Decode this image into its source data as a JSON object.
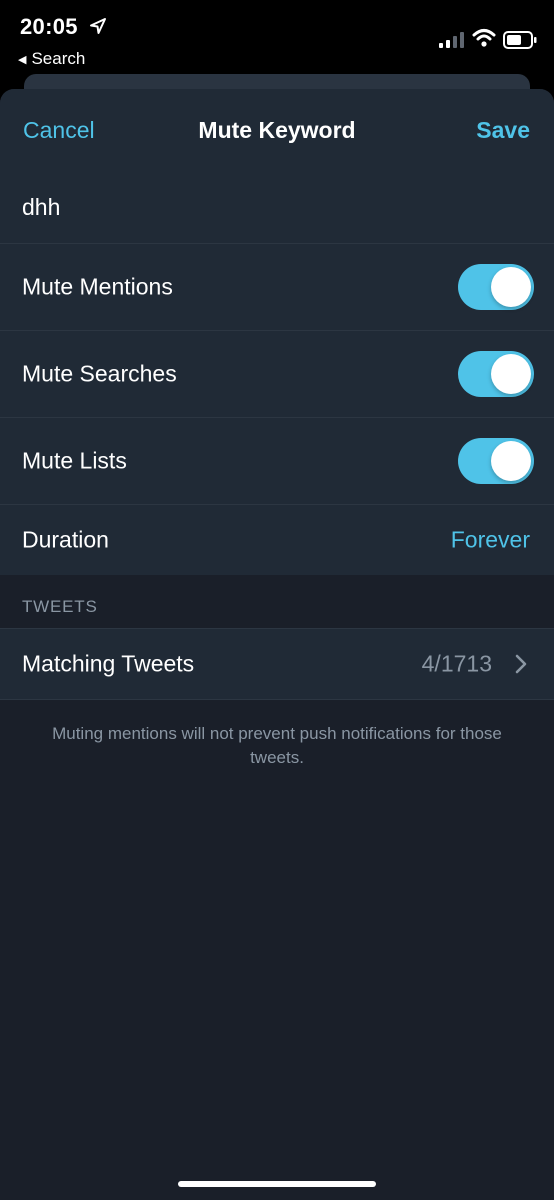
{
  "status_bar": {
    "time": "20:05",
    "back_app": "Search",
    "back_caret": "◀"
  },
  "nav": {
    "cancel_label": "Cancel",
    "title": "Mute Keyword",
    "save_label": "Save"
  },
  "keyword": {
    "value": "dhh"
  },
  "toggles": [
    {
      "label": "Mute Mentions",
      "on": true
    },
    {
      "label": "Mute Searches",
      "on": true
    },
    {
      "label": "Mute Lists",
      "on": true
    }
  ],
  "duration": {
    "label": "Duration",
    "value": "Forever"
  },
  "tweets_section": {
    "header": "TWEETS",
    "matching_label": "Matching Tweets",
    "matching_count": "4/1713"
  },
  "footer_note": "Muting mentions will not prevent push notifications for those tweets.",
  "colors": {
    "accent": "#4fc3e8",
    "sheet_bg": "#1a1f29",
    "cell_bg": "#202a36",
    "secondary_text": "#8a96a3"
  },
  "icons": {
    "location": "location-arrow-icon",
    "signal": "cellular-signal-icon",
    "wifi": "wifi-icon",
    "battery": "battery-icon",
    "chevron": "chevron-right-icon"
  }
}
